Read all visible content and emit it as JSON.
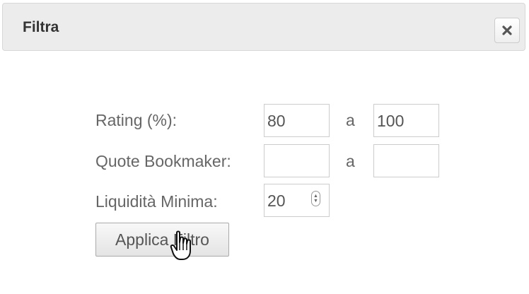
{
  "dialog": {
    "title": "Filtra",
    "close_icon": "close-icon"
  },
  "form": {
    "rating": {
      "label": "Rating (%):",
      "from": "80",
      "to": "100",
      "separator": "a"
    },
    "quote": {
      "label": "Quote Bookmaker:",
      "from": "",
      "to": "",
      "separator": "a"
    },
    "liquidity": {
      "label": "Liquidità Minima:",
      "value": "20"
    },
    "apply_label": "Applica Filtro"
  },
  "cursor_icon": "hand-pointer-icon"
}
